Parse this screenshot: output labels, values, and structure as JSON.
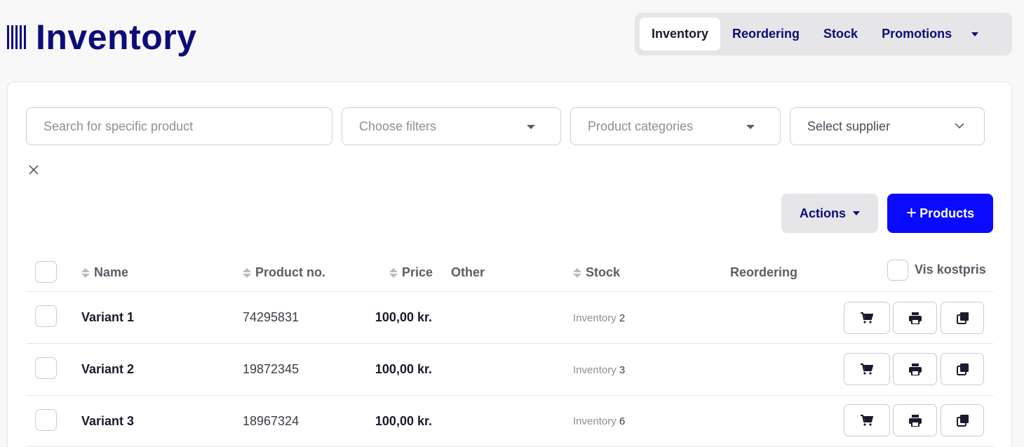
{
  "header": {
    "app_title": "Inventory",
    "tabs": [
      {
        "label": "Inventory",
        "active": true
      },
      {
        "label": "Reordering",
        "active": false
      },
      {
        "label": "Stock",
        "active": false
      },
      {
        "label": "Promotions",
        "active": false
      }
    ],
    "more_icon": "caret-down-icon"
  },
  "filters": {
    "search_placeholder": "Search for specific product",
    "choose_filters_placeholder": "Choose filters",
    "categories_placeholder": "Product categories",
    "supplier_value": "Select supplier",
    "clear_icon": "close-icon"
  },
  "toolbar": {
    "actions_label": "Actions",
    "add_products_label": "Products",
    "add_products_icon": "+"
  },
  "table": {
    "columns": {
      "name": "Name",
      "product_no": "Product no.",
      "price": "Price",
      "other": "Other",
      "stock": "Stock",
      "reordering": "Reordering",
      "cost_price_toggle": "Vis kostpris"
    },
    "rows": [
      {
        "name": "Variant 1",
        "product_no": "74295831",
        "price": "100,00 kr.",
        "stock_label": "Inventory",
        "stock_value": "2"
      },
      {
        "name": "Variant 2",
        "product_no": "19872345",
        "price": "100,00 kr.",
        "stock_label": "Inventory",
        "stock_value": "3"
      },
      {
        "name": "Variant 3",
        "product_no": "18967324",
        "price": "100,00 kr.",
        "stock_label": "Inventory",
        "stock_value": "6"
      }
    ],
    "row_action_icons": [
      "cart-icon",
      "print-icon",
      "copy-icon"
    ]
  },
  "colors": {
    "brand_navy": "#0c0c7a",
    "primary_blue": "#0a0aff",
    "tab_bg": "#e6e6e9"
  }
}
